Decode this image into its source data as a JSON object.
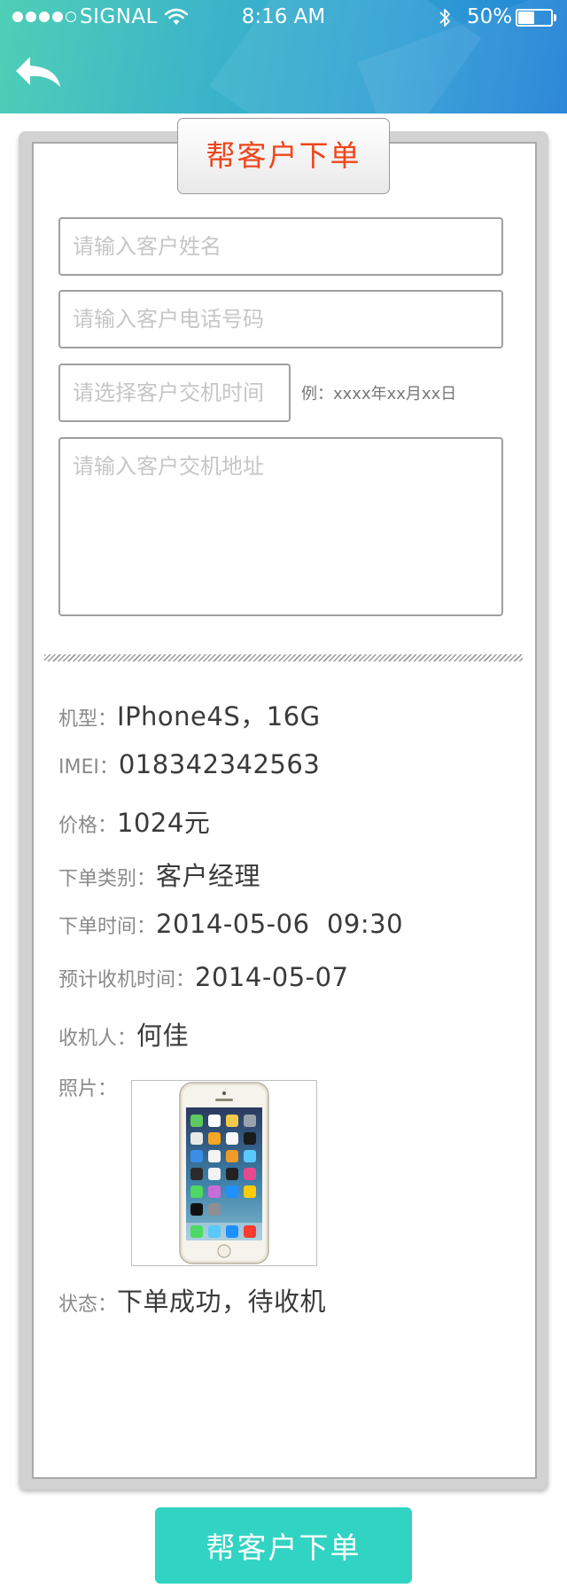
{
  "status_bar": {
    "carrier": "SIGNAL",
    "time": "8:16 AM",
    "battery_percent": "50%",
    "battery_level": 0.5,
    "signal_strength": 4,
    "signal_max": 5
  },
  "header": {
    "back_icon": "back-arrow-icon",
    "colors": {
      "gradient_start": "#4fcfb6",
      "gradient_end": "#1f7fd6"
    }
  },
  "form": {
    "title": "帮客户下单",
    "name_placeholder": "请输入客户姓名",
    "phone_placeholder": "请输入客户电话号码",
    "time_placeholder": "请选择客户交机时间",
    "time_hint": "例：xxxx年xx月xx日",
    "address_placeholder": "请输入客户交机地址"
  },
  "info": {
    "model_label": "机型：",
    "model_value": "IPhone4S，16G",
    "imei_label": "IMEI：",
    "imei_value": "018342342563",
    "price_label": "价格：",
    "price_value": "1024元",
    "type_label": "下单类别：",
    "type_value": "客户经理",
    "order_time_label": "下单时间：",
    "order_time_value": "2014-05-06  09:30",
    "collect_time_label": "预计收机时间：",
    "collect_time_value": "2014-05-07",
    "receiver_label": "收机人：",
    "receiver_value": "何佳",
    "photo_label": "照片：",
    "status_label": "状态：",
    "status_value": "下单成功，待收机"
  },
  "submit_button": {
    "label": "帮客户下单",
    "color": "#31d3c3"
  },
  "accent_colors": {
    "title": "#f0451a"
  }
}
